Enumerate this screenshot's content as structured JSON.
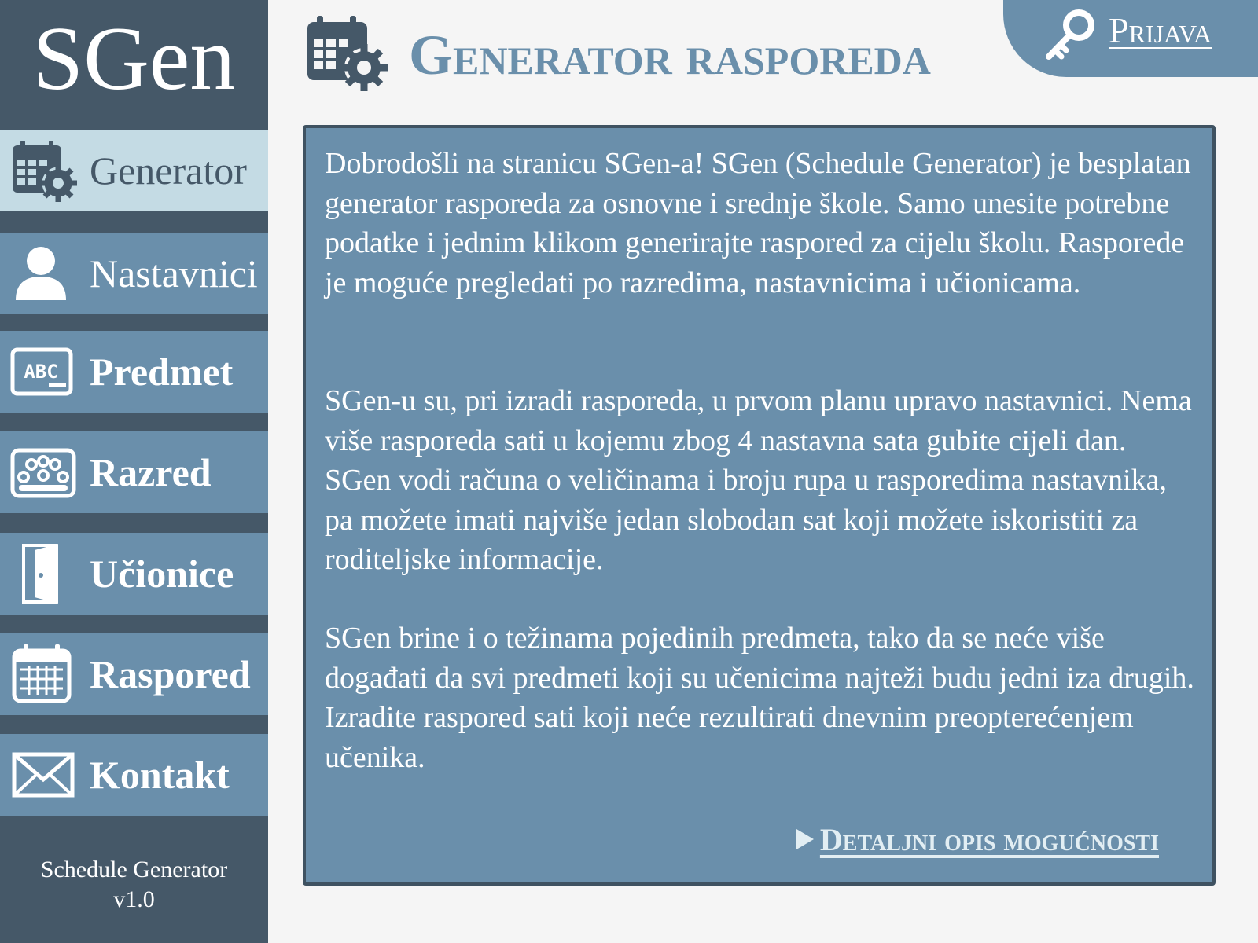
{
  "sidebar": {
    "logo": "SGen",
    "items": [
      {
        "label": "Generator",
        "icon": "calendar-gear-icon"
      },
      {
        "label": "Nastavnici",
        "icon": "user-icon"
      },
      {
        "label": "Predmet",
        "icon": "abc-board-icon"
      },
      {
        "label": "Razred",
        "icon": "group-icon"
      },
      {
        "label": "Učionice",
        "icon": "door-icon"
      },
      {
        "label": "Raspored",
        "icon": "calendar-icon"
      },
      {
        "label": "Kontakt",
        "icon": "envelope-icon"
      }
    ],
    "footer_line1": "Schedule Generator",
    "footer_line2": "v1.0"
  },
  "header": {
    "title": "Generator rasporeda",
    "icon": "calendar-gear-icon",
    "login_label": "Prijava",
    "login_icon": "key-icon"
  },
  "content": {
    "paragraph1": "Dobrodošli na stranicu SGen-a! SGen (Schedule Generator) je besplatan generator rasporeda za osnovne i srednje škole. Samo unesite potrebne podatke i jednim klikom generirajte raspored za cijelu školu. Rasporede je moguće pregledati po razredima, nastavnicima i učionicama.",
    "paragraph2": "SGen-u su, pri izradi rasporeda, u prvom planu upravo nastavnici. Nema više rasporeda sati u kojemu zbog 4 nastavna sata gubite cijeli dan. SGen vodi računa o veličinama i broju rupa u rasporedima nastavnika, pa možete imati najviše jedan slobodan sat koji možete iskoristiti za roditeljske informacije.",
    "paragraph3": "SGen brine i o težinama pojedinih predmeta, tako da se neće više događati da svi predmeti koji su učenicima najteži budu jedni iza drugih. Izradite raspored sati koji neće rezultirati dnevnim preopterećenjem učenika.",
    "more_link": "Detaljni opis mogućnosti"
  },
  "colors": {
    "sidebar_dark": "#455868",
    "accent": "#6a8fab",
    "active_item": "#c4dbe4",
    "background": "#f5f5f5"
  }
}
